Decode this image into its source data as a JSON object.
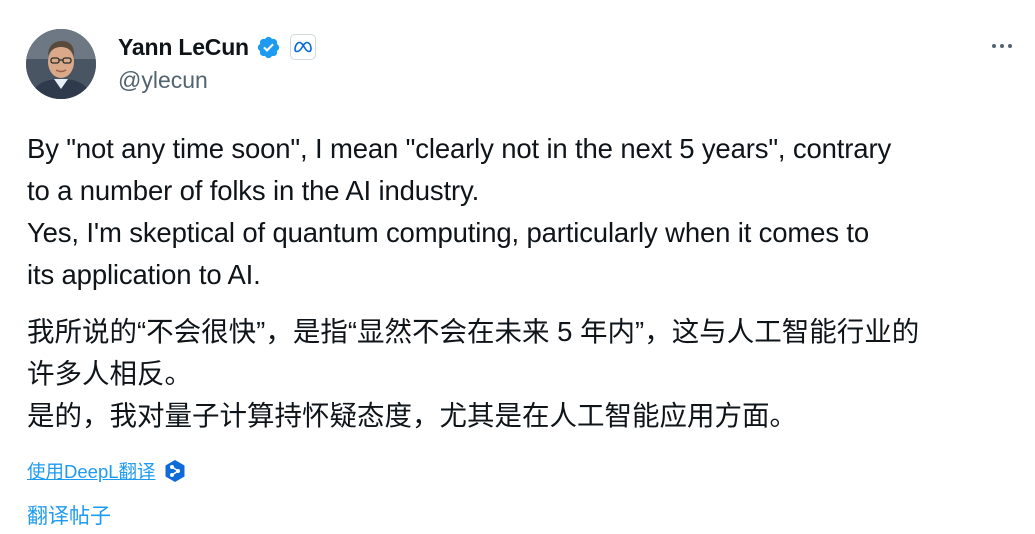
{
  "author": {
    "display_name": "Yann LeCun",
    "handle": "@ylecun",
    "verified_icon": "verified-badge-icon",
    "affiliation_icon": "meta-logo-icon"
  },
  "tweet": {
    "text_lines": [
      "By \"not any time soon\", I mean \"clearly not in the next 5 years\", contrary",
      "to a number of folks in the AI industry.",
      "Yes, I'm skeptical of quantum computing, particularly when it comes to",
      "its application to AI."
    ],
    "translation_lines": [
      "我所说的“不会很快”，是指“显然不会在未来 5 年内”，这与人工智能行业的",
      "许多人相反。",
      "是的，我对量子计算持怀疑态度，尤其是在人工智能应用方面。"
    ]
  },
  "actions": {
    "deepl_label": "使用DeepL翻译",
    "translate_label": "翻译帖子",
    "more_icon": "more-icon"
  },
  "colors": {
    "text": "#0f1419",
    "secondary": "#536471",
    "link": "#1d9bf0",
    "verified": "#1d9bf0",
    "meta": "#0668e1"
  }
}
